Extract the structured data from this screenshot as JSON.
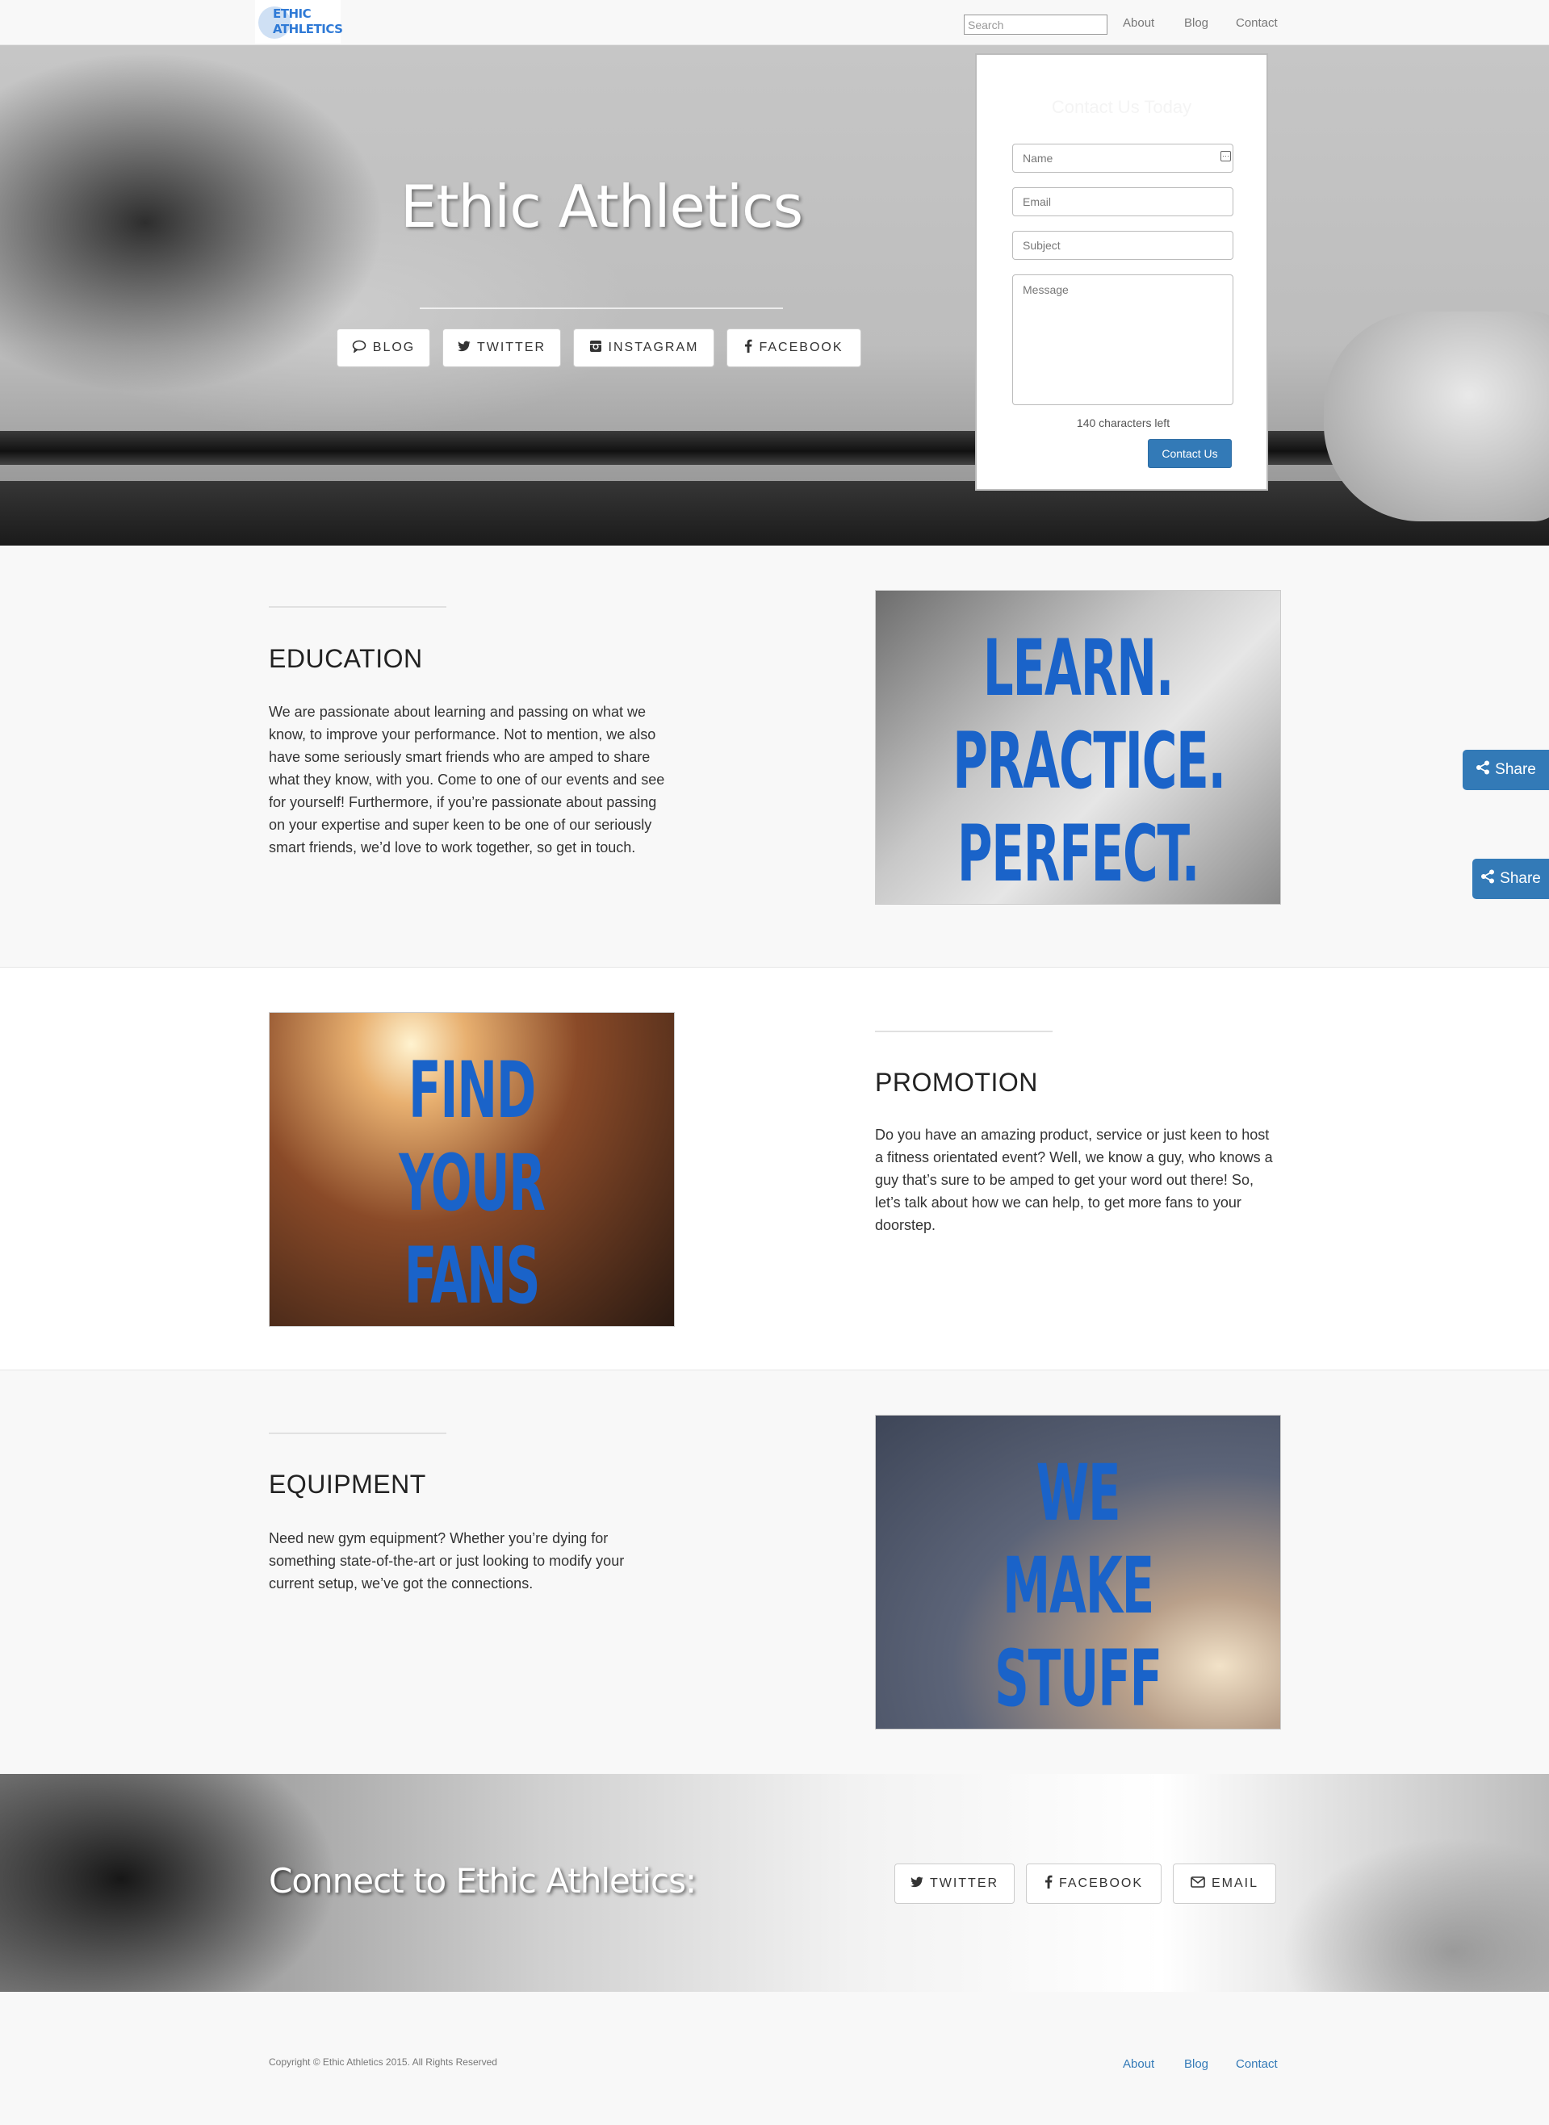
{
  "navbar": {
    "logo_line1": "ETHIC",
    "logo_line2": "ATHLETICS",
    "search_placeholder": "Search",
    "links": [
      "About",
      "Blog",
      "Contact"
    ]
  },
  "hero": {
    "title": "Ethic Athletics",
    "buttons": [
      {
        "label": "BLOG",
        "icon": "comment-icon"
      },
      {
        "label": "TWITTER",
        "icon": "twitter-icon"
      },
      {
        "label": "INSTAGRAM",
        "icon": "instagram-icon"
      },
      {
        "label": "FACEBOOK",
        "icon": "facebook-icon"
      }
    ]
  },
  "contact_form": {
    "title": "Contact Us Today",
    "name_placeholder": "Name",
    "email_placeholder": "Email",
    "subject_placeholder": "Subject",
    "message_placeholder": "Message",
    "chars_left": "140 characters left",
    "submit_label": "Contact Us"
  },
  "sections": {
    "education": {
      "title": "EDUCATION",
      "text": "We are passionate about learning and passing on what we know, to improve your performance. Not to mention, we also have some seriously smart friends who are amped to share what they know, with you. Come to one of our events and see for yourself! Furthermore, if you’re passionate about passing on your expertise and super keen to be one of our seriously smart friends, we’d love to work together, so get in touch.",
      "image_lines": [
        "LEARN.",
        "PRACTICE.",
        "PERFECT."
      ]
    },
    "promotion": {
      "title": "PROMOTION",
      "text": "Do you have an amazing product, service or just keen to host a fitness orientated event? Well, we know a guy, who knows a guy that’s sure to be amped to get your word out there! So, let’s talk about how we can help, to get more fans to your doorstep.",
      "image_lines": [
        "FIND",
        "YOUR",
        "FANS"
      ]
    },
    "equipment": {
      "title": "EQUIPMENT",
      "text": "Need new gym equipment? Whether you’re dying for something state-of-the-art or just looking to modify your current setup, we’ve got the connections.",
      "image_lines": [
        "WE",
        "MAKE",
        "STUFF"
      ]
    }
  },
  "share_buttons": [
    "Share",
    "Share"
  ],
  "connect": {
    "title": "Connect to Ethic Athletics:",
    "buttons": [
      {
        "label": "TWITTER",
        "icon": "twitter-icon"
      },
      {
        "label": "FACEBOOK",
        "icon": "facebook-icon"
      },
      {
        "label": "EMAIL",
        "icon": "envelope-icon"
      }
    ]
  },
  "footer": {
    "copyright": "Copyright © Ethic Athletics 2015. All Rights Reserved",
    "links": [
      "About",
      "Blog",
      "Contact"
    ]
  },
  "colors": {
    "accent": "#337ab7",
    "image_text": "#1a63c9",
    "nav_background": "#f8f8f8"
  }
}
